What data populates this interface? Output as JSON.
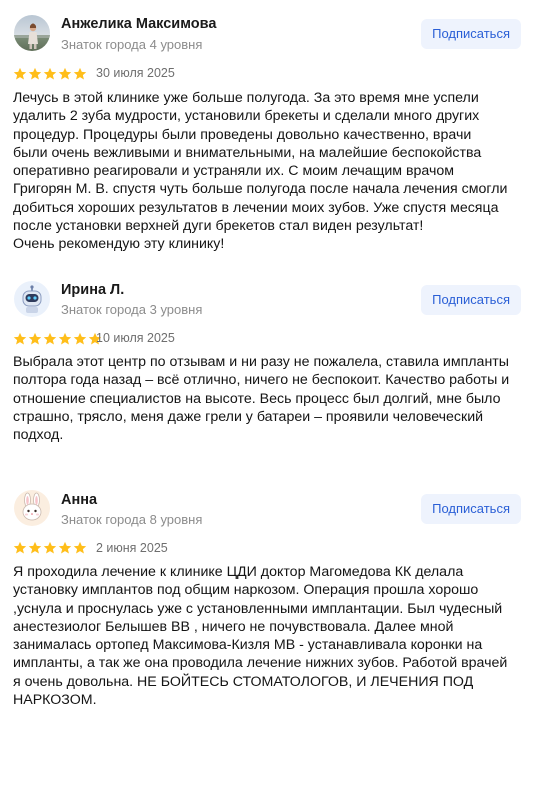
{
  "reviews": [
    {
      "author": "Анжелика Максимова",
      "level": "Знаток города 4 уровня",
      "subscribe_label": "Подписаться",
      "rating": 5,
      "date": "30 июля 2025",
      "text": "Лечусь в этой клинике уже больше полугода. За это время мне успели\nудалить 2 зуба мудрости, установили брекеты и сделали много других\nпроцедур. Процедуры были проведены довольно качественно, врачи\nбыли очень вежливыми и внимательными, на малейшие беспокойства\nоперативно реагировали и устраняли их. С моим лечащим врачом\nГригорян М. В. спустя чуть больше полугода после начала лечения смогли\nдобиться хороших результатов в лечении моих зубов. Уже спустя месяца\nпосле установки верхней дуги брекетов стал виден результат!\nОчень рекомендую эту клинику!"
    },
    {
      "author": "Ирина Л.",
      "level": "Знаток города 3 уровня",
      "subscribe_label": "Подписаться",
      "rating": 5,
      "date": "10 июля 2025",
      "text": "Выбрала этот центр по отзывам и ни разу не пожалела, ставила импланты\nполтора года назад – всё отлично, ничего не беспокоит. Качество работы и\nотношение специалистов на высоте. Весь процесс был долгий, мне было\nстрашно, трясло, меня даже грели у батареи – проявили человеческий\nподход."
    },
    {
      "author": "Анна",
      "level": "Знаток города 8 уровня",
      "subscribe_label": "Подписаться",
      "rating": 5,
      "date": "2 июня 2025",
      "text": "Я проходила лечение к клинике ЦДИ доктор Магомедова КК делала\nустановку имплантов под общим наркозом. Операция прошла хорошо\n,уснула и проснулась уже с установленными имплантации. Был чудесный\nанестезиолог Белышев ВВ , ничего не почувствовала. Далее мной\nзанималась ортопед Максимова-Кизля МВ - устанавливала коронки на\nимпланты, а так же она проводила лечение нижних зубов. Работой врачей\nя очень довольна. НЕ БОЙТЕСЬ СТОМАТОЛОГОВ, И ЛЕЧЕНИЯ ПОД\nНАРКОЗОМ."
    }
  ],
  "colors": {
    "star": "#ffbe1a",
    "subscribe_bg": "#eef3fd",
    "subscribe_text": "#2a5fd6"
  },
  "icons": {
    "avatar_1": "user-photo",
    "avatar_2": "robot-avatar-icon",
    "avatar_3": "bunny-avatar-icon",
    "star": "star-icon"
  }
}
